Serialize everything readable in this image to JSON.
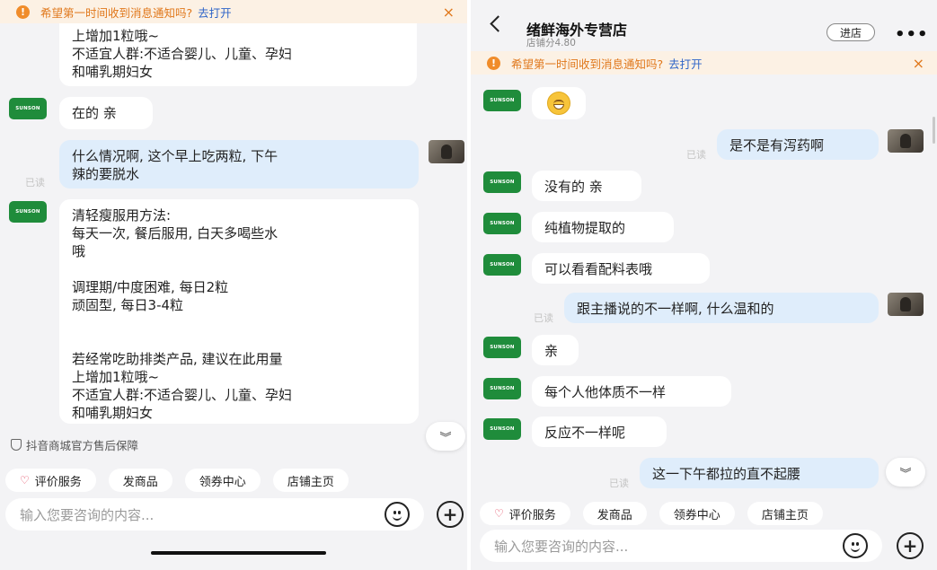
{
  "shop_badge": "SUNSON",
  "notice": {
    "text": "希望第一时间收到消息通知吗?",
    "link": "去打开",
    "close": "×"
  },
  "read_label": "已读",
  "left": {
    "msg_top_fragment": "上增加1粒哦~\n不适宜人群:不适合婴儿、儿童、孕妇\n和哺乳期妇女",
    "msg_zai": "在的 亲",
    "msg_user": "什么情况啊, 这个早上吃两粒, 下午\n辣的要脱水",
    "msg_instructions": "清轻瘦服用方法:\n每天一次, 餐后服用, 白天多喝些水\n哦\n\n调理期/中度困难, 每日2粒\n顽固型, 每日3-4粒\n\n\n若经常吃助排类产品, 建议在此用量\n上增加1粒哦~\n不适宜人群:不适合婴儿、儿童、孕妇\n和哺乳期妇女",
    "guarantee": "抖音商城官方售后保障"
  },
  "quick_actions": [
    "评价服务",
    "发商品",
    "领券中心",
    "店铺主页"
  ],
  "input_placeholder": "输入您要咨询的内容...",
  "right": {
    "shop_name": "绪鲜海外专营店",
    "shop_score": "店铺分4.80",
    "enter_button": "进店",
    "more": "•••",
    "messages": {
      "laxative": "是不是有泻药啊",
      "none": "没有的 亲",
      "plant": "纯植物提取的",
      "ingredients": "可以看看配料表哦",
      "anchor": "跟主播说的不一样啊, 什么温和的",
      "qin": "亲",
      "constitution": "每个人他体质不一样",
      "reaction": "反应不一样呢",
      "afternoon": "这一下午都拉的直不起腰"
    }
  }
}
